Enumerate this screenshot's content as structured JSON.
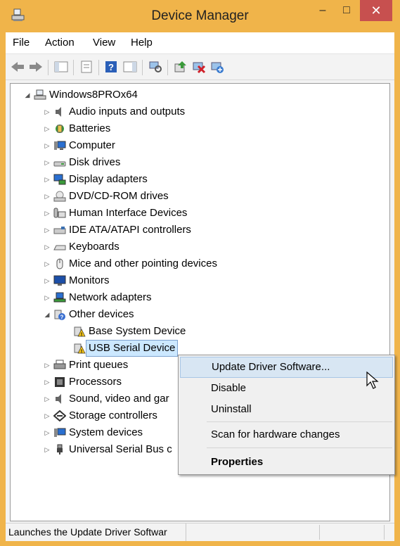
{
  "window": {
    "title": "Device Manager",
    "minimize": "–",
    "maximize": "□",
    "close": "✕"
  },
  "menu": [
    "File",
    "Action",
    "View",
    "Help"
  ],
  "tree": {
    "root": "Windows8PROx64",
    "items": [
      "Audio inputs and outputs",
      "Batteries",
      "Computer",
      "Disk drives",
      "Display adapters",
      "DVD/CD-ROM drives",
      "Human Interface Devices",
      "IDE ATA/ATAPI controllers",
      "Keyboards",
      "Mice and other pointing devices",
      "Monitors",
      "Network adapters",
      "Other devices",
      "Base System Device",
      "USB Serial Device",
      "Print queues",
      "Processors",
      "Sound, video and gar",
      "Storage controllers",
      "System devices",
      "Universal Serial Bus c"
    ]
  },
  "context_menu": {
    "update": "Update Driver Software...",
    "disable": "Disable",
    "uninstall": "Uninstall",
    "scan": "Scan for hardware changes",
    "properties": "Properties"
  },
  "status": {
    "text": "Launches the Update Driver Softwar"
  },
  "colors": {
    "title_bar": "#f0b44a",
    "close_button": "#c7504f",
    "selection": "#cce8ff",
    "menu_highlight": "#d8e6f3"
  }
}
